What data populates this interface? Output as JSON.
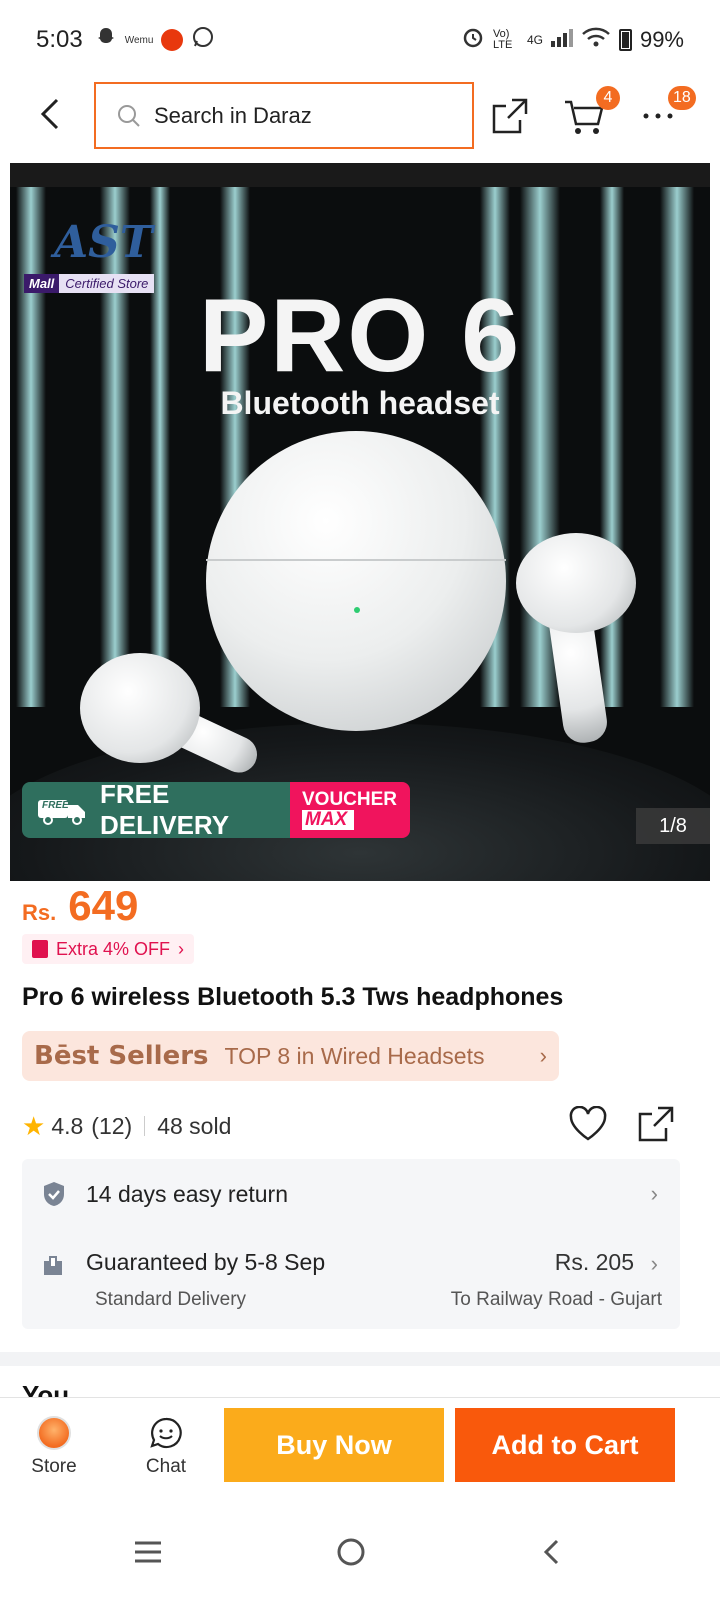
{
  "status_bar": {
    "time": "5:03",
    "notif_app": "Wemu",
    "network": "Vo) LTE",
    "signal": "4G",
    "battery": "99%"
  },
  "header": {
    "search_placeholder": "Search in Daraz",
    "cart_count": "4",
    "more_count": "18",
    "accent_color": "#f36c21"
  },
  "product_image": {
    "brand": "AST",
    "mall_label": "Mall",
    "certified_label": "Certified Store",
    "headline": "PRO 6",
    "subheadline": "Bluetooth headset",
    "promo_free_badge": "FREE",
    "promo_free_delivery": "FREE DELIVERY",
    "promo_voucher_line1": "VOUCHER",
    "promo_voucher_line2": "MAX",
    "counter": "1/8"
  },
  "product": {
    "currency": "Rs.",
    "price": "649",
    "extra_off": "Extra 4% OFF",
    "title": "Pro 6 wireless Bluetooth 5.3 Tws headphones",
    "best_sellers_logo": "Bēst Sellers",
    "best_sellers_text": "TOP 8 in Wired Headsets",
    "rating": "4.8",
    "review_count": "(12)",
    "sold": "48 sold"
  },
  "services": {
    "return_text": "14 days easy return",
    "delivery_text": "Guaranteed by 5-8 Sep",
    "delivery_type": "Standard Delivery",
    "delivery_fee": "Rs. 205",
    "destination": "To Railway Road - Gujart"
  },
  "next_section_heading": "You ",
  "action_bar": {
    "store_label": "Store",
    "chat_label": "Chat",
    "buy_now_label": "Buy Now",
    "add_to_cart_label": "Add to Cart",
    "buy_now_color": "#fbab1b",
    "add_to_cart_color": "#f9590c"
  }
}
